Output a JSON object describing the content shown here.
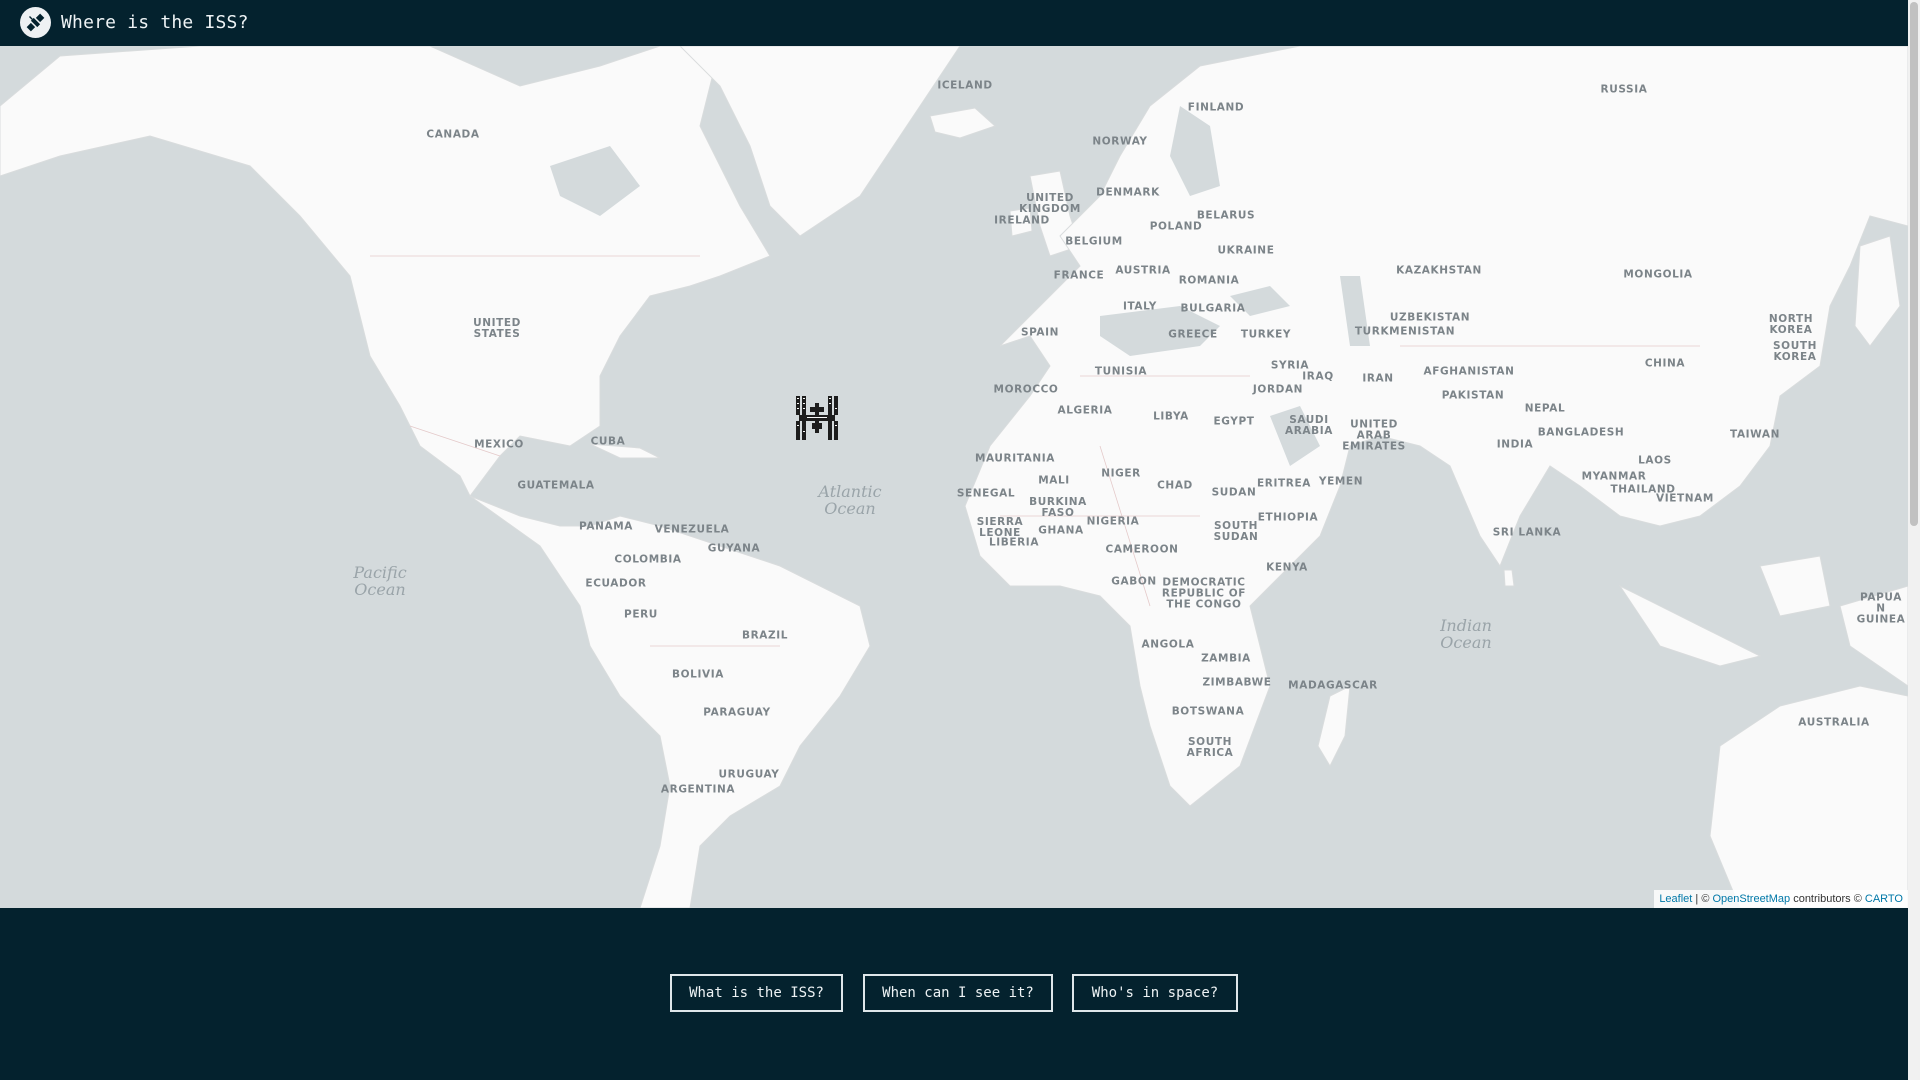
{
  "header": {
    "title": "Where is the ISS?",
    "logo_icon": "satellite-icon"
  },
  "map": {
    "iss_marker_icon": "iss-station-icon",
    "oceans": {
      "atlantic": "Atlantic\nOcean",
      "pacific": "Pacific\nOcean",
      "indian": "Indian\nOcean"
    },
    "countries": {
      "iceland": "ICELAND",
      "finland": "FINLAND",
      "russia": "RUSSIA",
      "canada": "CANADA",
      "norway": "NORWAY",
      "uk": "UNITED\nKINGDOM",
      "ireland": "IRELAND",
      "denmark": "DENMARK",
      "belarus": "BELARUS",
      "poland": "POLAND",
      "belgium": "BELGIUM",
      "ukraine": "UKRAINE",
      "kazakhstan": "KAZAKHSTAN",
      "mongolia": "MONGOLIA",
      "austria": "AUSTRIA",
      "france": "FRANCE",
      "romania": "ROMANIA",
      "italy": "ITALY",
      "bulgaria": "BULGARIA",
      "usa": "UNITED\nSTATES",
      "spain": "SPAIN",
      "greece": "GREECE",
      "turkey": "TURKEY",
      "uzbekistan": "UZBEKISTAN",
      "turkmenistan": "TURKMENISTAN",
      "north_korea": "NORTH\nKOREA",
      "south_korea": "SOUTH\nKOREA",
      "syria": "SYRIA",
      "tunisia": "TUNISIA",
      "iraq": "IRAQ",
      "afghanistan": "AFGHANISTAN",
      "china": "CHINA",
      "iran": "IRAN",
      "morocco": "MOROCCO",
      "jordan": "JORDAN",
      "pakistan": "PAKISTAN",
      "nepal": "NEPAL",
      "algeria": "ALGERIA",
      "libya": "LIBYA",
      "egypt": "EGYPT",
      "saudi_arabia": "SAUDI\nARABIA",
      "uae": "UNITED\nARAB\nEMIRATES",
      "bangladesh": "BANGLADESH",
      "taiwan": "TAIWAN",
      "mexico": "MEXICO",
      "cuba": "CUBA",
      "india": "INDIA",
      "mauritania": "MAURITANIA",
      "laos": "LAOS",
      "myanmar": "MYANMAR",
      "niger": "NIGER",
      "mali": "MALI",
      "eritrea": "ERITREA",
      "yemen": "YEMEN",
      "thailand": "THAILAND",
      "guatemala": "GUATEMALA",
      "chad": "CHAD",
      "sudan": "SUDAN",
      "vietnam": "VIETNAM",
      "senegal": "SENEGAL",
      "burkina_faso": "BURKINA\nFASO",
      "panama": "PANAMA",
      "venezuela": "VENEZUELA",
      "nigeria": "NIGERIA",
      "ethiopia": "ETHIOPIA",
      "sierra_leone": "SIERRA\nLEONE",
      "ghana": "GHANA",
      "south_sudan": "SOUTH\nSUDAN",
      "sri_lanka": "SRI LANKA",
      "liberia": "LIBERIA",
      "guyana": "GUYANA",
      "cameroon": "CAMEROON",
      "colombia": "COLOMBIA",
      "kenya": "KENYA",
      "ecuador": "ECUADOR",
      "gabon": "GABON",
      "drc": "DEMOCRATIC\nREPUBLIC OF\nTHE CONGO",
      "papua": "PAPUA N\nGUINEA",
      "peru": "PERU",
      "brazil": "BRAZIL",
      "angola": "ANGOLA",
      "zambia": "ZAMBIA",
      "bolivia": "BOLIVIA",
      "zimbabwe": "ZIMBABWE",
      "madagascar": "MADAGASCAR",
      "paraguay": "PARAGUAY",
      "botswana": "BOTSWANA",
      "australia": "AUSTRALIA",
      "south_africa": "SOUTH\nAFRICA",
      "uruguay": "URUGUAY",
      "argentina": "ARGENTINA"
    },
    "attribution": {
      "leaflet": "Leaflet",
      "sep": " | © ",
      "osm": "OpenStreetMap",
      "contrib": " contributors © ",
      "carto": "CARTO"
    }
  },
  "footer": {
    "buttons": [
      "What is the ISS?",
      "When can I see it?",
      "Who's in space?"
    ]
  }
}
